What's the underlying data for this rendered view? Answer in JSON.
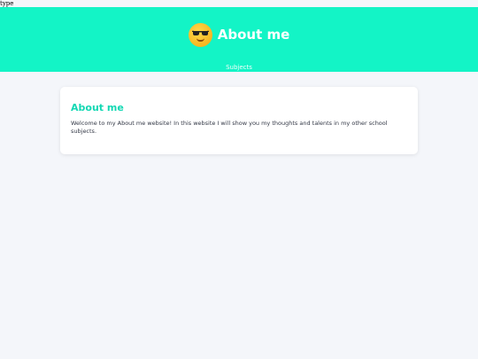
{
  "stray_text": "type",
  "header": {
    "background_color": "#13f4c6",
    "logo_icon": "sunglasses-emoji-icon",
    "title": "About me",
    "nav_link": "Subjects"
  },
  "main": {
    "card": {
      "title": "About me",
      "text": "Welcome to my About me website! In this website I will show you my thoughts and talents in my other school subjects."
    }
  },
  "colors": {
    "page_background": "#f4f6fa",
    "card_title": "#13d8b3",
    "card_background": "#ffffff"
  }
}
